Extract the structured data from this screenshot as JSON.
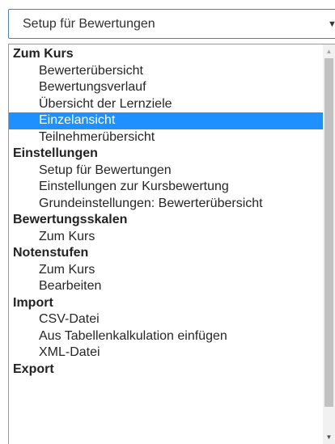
{
  "select": {
    "value": "Setup für Bewertungen",
    "arrow_icon": "chevron-down-icon"
  },
  "dropdown": {
    "groups": [
      {
        "label": "Zum Kurs",
        "options": [
          {
            "label": "Bewerterübersicht",
            "selected": false
          },
          {
            "label": "Bewertungsverlauf",
            "selected": false
          },
          {
            "label": "Übersicht der Lernziele",
            "selected": false
          },
          {
            "label": "Einzelansicht",
            "selected": true
          },
          {
            "label": "Teilnehmerübersicht",
            "selected": false
          }
        ]
      },
      {
        "label": "Einstellungen",
        "options": [
          {
            "label": "Setup für Bewertungen",
            "selected": false
          },
          {
            "label": "Einstellungen zur Kursbewertung",
            "selected": false
          },
          {
            "label": "Grundeinstellungen: Bewerterübersicht",
            "selected": false
          }
        ]
      },
      {
        "label": "Bewertungsskalen",
        "options": [
          {
            "label": "Zum Kurs",
            "selected": false
          }
        ]
      },
      {
        "label": "Notenstufen",
        "options": [
          {
            "label": "Zum Kurs",
            "selected": false
          },
          {
            "label": "Bearbeiten",
            "selected": false
          }
        ]
      },
      {
        "label": "Import",
        "options": [
          {
            "label": "CSV-Datei",
            "selected": false
          },
          {
            "label": "Aus Tabellenkalkulation einfügen",
            "selected": false
          },
          {
            "label": "XML-Datei",
            "selected": false
          }
        ]
      },
      {
        "label": "Export",
        "options": []
      }
    ],
    "highlight_color": "#1e90ff"
  },
  "scrollbar": {
    "up_icon": "scroll-up-arrow-icon",
    "down_icon": "scroll-down-arrow-icon"
  }
}
